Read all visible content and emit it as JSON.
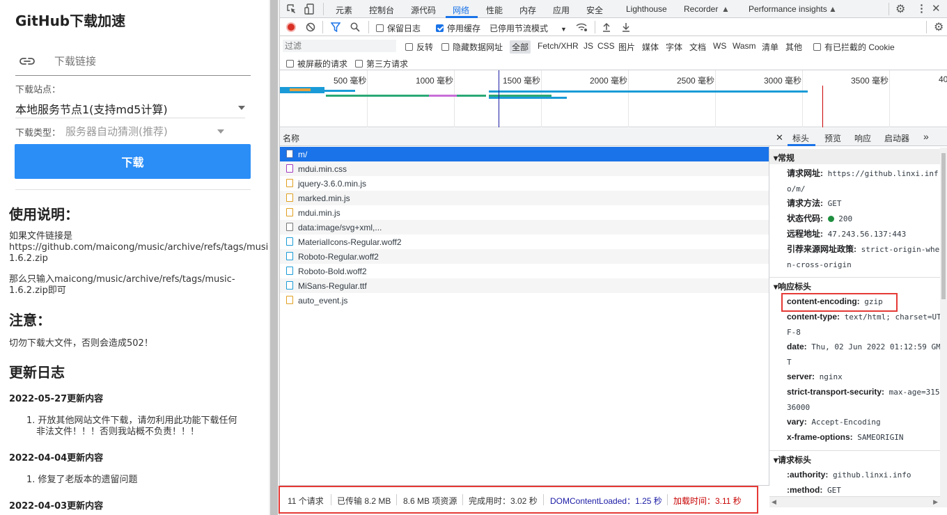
{
  "page": {
    "title": "GitHub下载加速",
    "link_placeholder": "下载链接",
    "site_label": "下载站点：",
    "site_value": "本地服务节点1(支持md5计算)",
    "type_label": "下载类型：",
    "type_value": "服务器自动猜测(推荐)",
    "download_button": "下载",
    "usage_title": "使用说明：",
    "usage_p1_line1": "如果文件链接是",
    "usage_p1_line2": "https://github.com/maicong/music/archive/refs/tags/music-",
    "usage_p1_line3": "1.6.2.zip",
    "usage_p2_line1": "那么只输入maicong/music/archive/refs/tags/music-",
    "usage_p2_line2": "1.6.2.zip即可",
    "notice_title": "注意：",
    "notice_text": "切勿下载大文件，否则会造成502！",
    "changelog_title": "更新日志",
    "entries": [
      {
        "date": "2022-05-27更新内容",
        "item_line1": "1. 开放其他网站文件下载，请勿利用此功能下载任何",
        "item_line2": "非法文件！！！否则我站概不负责！！！"
      },
      {
        "date": "2022-04-04更新内容",
        "item_line1": "1. 修复了老版本的遗留问题",
        "item_line2": ""
      },
      {
        "date": "2022-04-03更新内容",
        "item_line1": "",
        "item_line2": ""
      }
    ]
  },
  "devtools": {
    "tabs": [
      "元素",
      "控制台",
      "源代码",
      "网络",
      "性能",
      "内存",
      "应用",
      "安全",
      "Lighthouse",
      "Recorder",
      "Performance insights"
    ],
    "active_tab": "网络",
    "toolbar": {
      "preserve_log": "保留日志",
      "disable_cache": "停用缓存",
      "throttle": "已停用节流模式"
    },
    "filter": {
      "placeholder": "过滤",
      "invert": "反转",
      "hide_data_urls": "隐藏数据网址",
      "types": [
        "全部",
        "Fetch/XHR",
        "JS",
        "CSS",
        "图片",
        "媒体",
        "字体",
        "文档",
        "WS",
        "Wasm",
        "清单",
        "其他"
      ],
      "blocked_cookies": "有已拦截的 Cookie",
      "blocked_requests": "被屏蔽的请求",
      "third_party": "第三方请求"
    },
    "timeline_ticks": [
      "500 毫秒",
      "1000 毫秒",
      "1500 毫秒",
      "2000 毫秒",
      "2500 毫秒",
      "3000 毫秒",
      "3500 毫秒",
      "40"
    ],
    "list_header": "名称",
    "requests": [
      {
        "name": "m/",
        "type": "doc"
      },
      {
        "name": "mdui.min.css",
        "type": "css"
      },
      {
        "name": "jquery-3.6.0.min.js",
        "type": "js"
      },
      {
        "name": "marked.min.js",
        "type": "js"
      },
      {
        "name": "mdui.min.js",
        "type": "js"
      },
      {
        "name": "data:image/svg+xml,...",
        "type": "img"
      },
      {
        "name": "MaterialIcons-Regular.woff2",
        "type": "font"
      },
      {
        "name": "Roboto-Regular.woff2",
        "type": "font"
      },
      {
        "name": "Roboto-Bold.woff2",
        "type": "font"
      },
      {
        "name": "MiSans-Regular.ttf",
        "type": "font"
      },
      {
        "name": "auto_event.js",
        "type": "js"
      }
    ],
    "detail_tabs": [
      "标头",
      "预览",
      "响应",
      "启动器"
    ],
    "general_title": "常规",
    "general": [
      {
        "k": "请求网址:",
        "v": "https://github.linxi.info/m/"
      },
      {
        "k": "请求方法:",
        "v": "GET"
      },
      {
        "k": "状态代码:",
        "v": "200"
      },
      {
        "k": "远程地址:",
        "v": "47.243.56.137:443"
      },
      {
        "k": "引荐来源网址政策:",
        "v": "strict-origin-when-cross-origin"
      }
    ],
    "response_title": "响应标头",
    "response": [
      {
        "k": "content-encoding:",
        "v": "gzip"
      },
      {
        "k": "content-type:",
        "v": "text/html; charset=UTF-8"
      },
      {
        "k": "date:",
        "v": "Thu, 02 Jun 2022 01:12:59 GMT"
      },
      {
        "k": "server:",
        "v": "nginx"
      },
      {
        "k": "strict-transport-security:",
        "v": "max-age=31536000"
      },
      {
        "k": "vary:",
        "v": "Accept-Encoding"
      },
      {
        "k": "x-frame-options:",
        "v": "SAMEORIGIN"
      }
    ],
    "request_title": "请求标头",
    "request": [
      {
        "k": ":authority:",
        "v": "github.linxi.info"
      },
      {
        "k": ":method:",
        "v": "GET"
      }
    ],
    "status": {
      "requests": "11 个请求",
      "transferred": "已传输 8.2 MB",
      "resources": "8.6 MB 项资源",
      "finish": "完成用时：3.02 秒",
      "dcl": "DOMContentLoaded：1.25 秒",
      "load": "加载时间：3.11 秒"
    },
    "colors": {
      "accent": "#1a73e8",
      "dcl": "#1a1aa6",
      "load": "#c80000",
      "highlight": "#e53935"
    }
  }
}
